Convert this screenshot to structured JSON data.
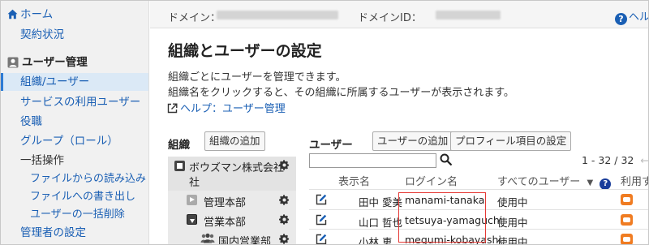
{
  "sidebar": {
    "home": "ホーム",
    "contract": "契約状況",
    "user_mgmt_section": "ユーザー管理",
    "items": [
      {
        "label": "組織/ユーザー",
        "active": true
      },
      {
        "label": "サービスの利用ユーザー"
      },
      {
        "label": "役職"
      },
      {
        "label": "グループ（ロール）"
      }
    ],
    "bulk_label": "一括操作",
    "bulk_items": [
      "ファイルからの読み込み",
      "ファイルへの書き出し",
      "ユーザーの一括削除"
    ],
    "admin_settings": "管理者の設定"
  },
  "topbar": {
    "domain_label": "ドメイン：",
    "domain_id_label": "ドメインID：",
    "help": "ヘル"
  },
  "main": {
    "title": "組織とユーザーの設定",
    "desc1": "組織ごとにユーザーを管理できます。",
    "desc2": "組織名をクリックすると、その組織に所属するユーザーが表示されます。",
    "help_link": "ヘルプ：ユーザー管理"
  },
  "org": {
    "heading": "組織",
    "add_button": "組織の追加",
    "tree": [
      {
        "label": "ボウズマン株式会社",
        "line2": "社",
        "state": "root"
      },
      {
        "label": "管理本部",
        "state": "collapsed"
      },
      {
        "label": "営業本部",
        "state": "expanded"
      },
      {
        "label": "国内営業部",
        "state": "group"
      }
    ]
  },
  "users": {
    "heading": "ユーザー",
    "add_button": "ユーザーの追加",
    "profile_button": "プロフィール項目の設定",
    "search_placeholder": "",
    "pager": "1 - 32 / 32",
    "prev_arrow": "←",
    "next_arrow": "→",
    "columns": {
      "display_name": "表示名",
      "login_name": "ログイン名",
      "filter_all": "すべてのユーザー",
      "filter_caret": "▼",
      "filter_help": "?",
      "app": "利用す"
    },
    "rows": [
      {
        "name": "田中 愛美",
        "login": "manami-tanaka",
        "status": "使用中"
      },
      {
        "name": "山口 哲也",
        "login": "tetsuya-yamaguchi",
        "status": "使用中"
      },
      {
        "name": "小林 恵",
        "login": "megumi-kobayashi",
        "status": "使用中"
      }
    ]
  },
  "colors": {
    "link": "#1a5fb4",
    "highlight_box": "#e53935",
    "app_icon": "#f07c22"
  }
}
